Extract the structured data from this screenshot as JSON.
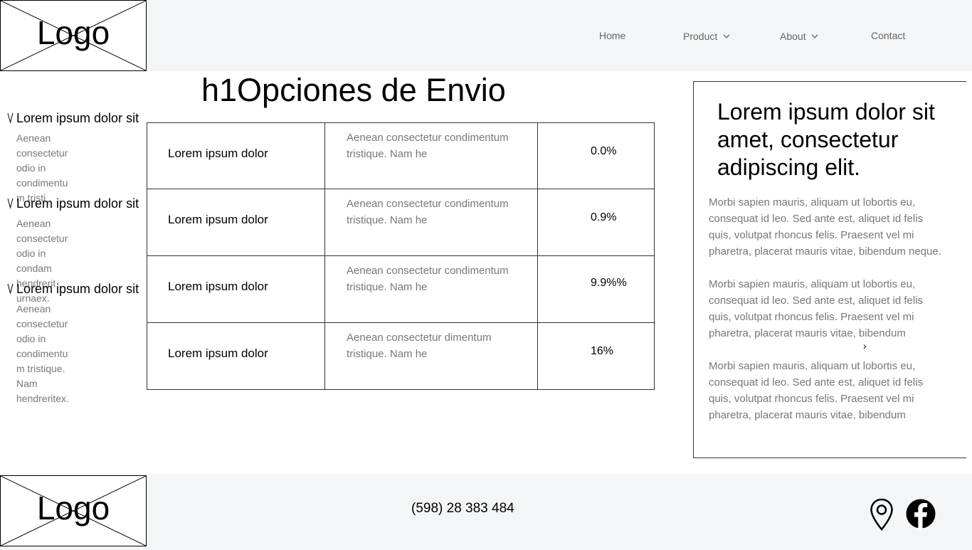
{
  "header": {
    "logo_text": "Logo",
    "nav": [
      {
        "label": "Home"
      },
      {
        "label": "Product"
      },
      {
        "label": "About"
      },
      {
        "label": "Contact"
      }
    ]
  },
  "page_title": "h1Opciones de Envio",
  "accordion": [
    {
      "title": "Lorem ipsum dolor sit",
      "body": "Aenean consectetur odio in condimentu m tristi"
    },
    {
      "title": "Lorem ipsum dolor sit",
      "body": "Aenean consectetur odio in condam hendrerit urnaex."
    },
    {
      "title": "Lorem ipsum dolor sit",
      "body": "Aenean consectetur odio in condimentu m tristique. Nam hendreritex."
    }
  ],
  "table": {
    "rows": [
      {
        "name": "Lorem ipsum dolor",
        "desc": "Aenean consectetur condimentum tristique. Nam he",
        "value": "0.0%"
      },
      {
        "name": "Lorem ipsum dolor",
        "desc": "Aenean consectetur condimentum tristique. Nam he",
        "value": "0.9%"
      },
      {
        "name": "Lorem ipsum dolor",
        "desc": "Aenean consectetur condimentum tristique. Nam he",
        "value": "9.9%%"
      },
      {
        "name": "Lorem ipsum dolor",
        "desc": "Aenean consectetur dimentum tristique. Nam he",
        "value": "16%"
      }
    ]
  },
  "card": {
    "title": "Lorem ipsum dolor sit amet, consectetur adipiscing elit.",
    "para1": "Morbi sapien mauris, aliquam ut lobortis eu, consequat id leo. Sed ante est, aliquet id felis quis, volutpat rhoncus felis. Praesent vel mi pharetra, placerat mauris vitae, bibendum neque.",
    "para2": "Morbi sapien mauris, aliquam ut lobortis eu, consequat id leo. Sed ante est, aliquet id felis quis, volutpat rhoncus felis. Praesent vel mi pharetra, placerat mauris vitae, bibendum",
    "para3": "Morbi sapien mauris, aliquam ut lobortis eu, consequat id leo. Sed ante est, aliquet id felis quis, volutpat rhoncus felis. Praesent vel mi pharetra, placerat mauris vitae, bibendum",
    "more_glyph": "›"
  },
  "footer": {
    "logo_text": "Logo",
    "phone": "(598) 28 383 484",
    "icons": [
      "map-pin-icon",
      "facebook-icon"
    ]
  }
}
